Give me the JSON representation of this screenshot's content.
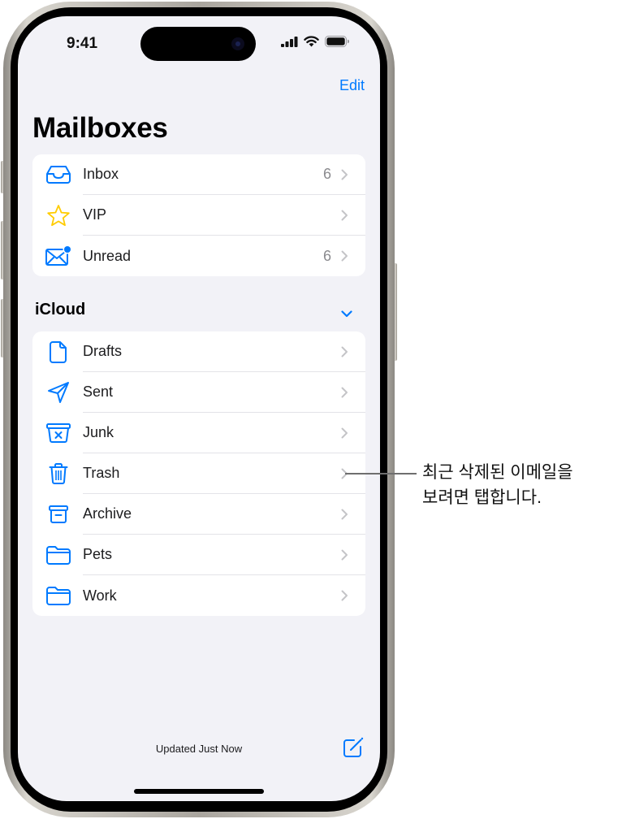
{
  "status_bar": {
    "time": "9:41",
    "icons": [
      "cellular-signal-icon",
      "wifi-icon",
      "battery-icon"
    ]
  },
  "nav": {
    "edit_label": "Edit",
    "title": "Mailboxes"
  },
  "smart_mailboxes": [
    {
      "label": "Inbox",
      "count": "6",
      "icon": "inbox-tray-icon"
    },
    {
      "label": "VIP",
      "count": "",
      "icon": "star-icon"
    },
    {
      "label": "Unread",
      "count": "6",
      "icon": "envelope-unread-icon"
    }
  ],
  "account_section": {
    "title": "iCloud",
    "expanded": true,
    "folders": [
      {
        "label": "Drafts",
        "icon": "document-icon"
      },
      {
        "label": "Sent",
        "icon": "paperplane-icon"
      },
      {
        "label": "Junk",
        "icon": "junk-bin-icon"
      },
      {
        "label": "Trash",
        "icon": "trash-icon"
      },
      {
        "label": "Archive",
        "icon": "archive-box-icon"
      },
      {
        "label": "Pets",
        "icon": "folder-icon"
      },
      {
        "label": "Work",
        "icon": "folder-icon"
      }
    ]
  },
  "toolbar": {
    "status": "Updated Just Now",
    "compose_icon": "compose-icon"
  },
  "callout": {
    "text": "최근 삭제된 이메일을\n보려면 탭합니다."
  },
  "colors": {
    "accent": "#007aff",
    "vip_star": "#ffcc00",
    "background": "#f2f2f7"
  }
}
